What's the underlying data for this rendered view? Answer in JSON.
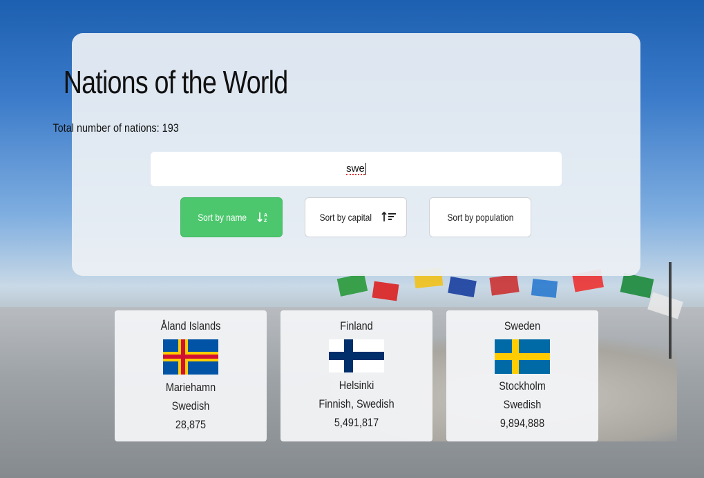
{
  "header": {
    "title": "Nations of the World",
    "total_label": "Total number of nations: 193"
  },
  "search": {
    "value": "swe"
  },
  "sort_buttons": [
    {
      "label": "Sort by name",
      "icon": "sort-alpha-down-icon",
      "active": true
    },
    {
      "label": "Sort by capital",
      "icon": "sort-amount-down-icon",
      "active": false
    },
    {
      "label": "Sort by population",
      "icon": "",
      "active": false
    }
  ],
  "countries": [
    {
      "name": "Åland Islands",
      "capital": "Mariehamn",
      "languages": "Swedish",
      "population": "28,875",
      "flag": "aland-flag"
    },
    {
      "name": "Finland",
      "capital": "Helsinki",
      "languages": "Finnish, Swedish",
      "population": "5,491,817",
      "flag": "finland-flag"
    },
    {
      "name": "Sweden",
      "capital": "Stockholm",
      "languages": "Swedish",
      "population": "9,894,888",
      "flag": "sweden-flag"
    }
  ],
  "colors": {
    "active_button": "#4cc76d",
    "panel_bg": "#ecf0f4"
  }
}
